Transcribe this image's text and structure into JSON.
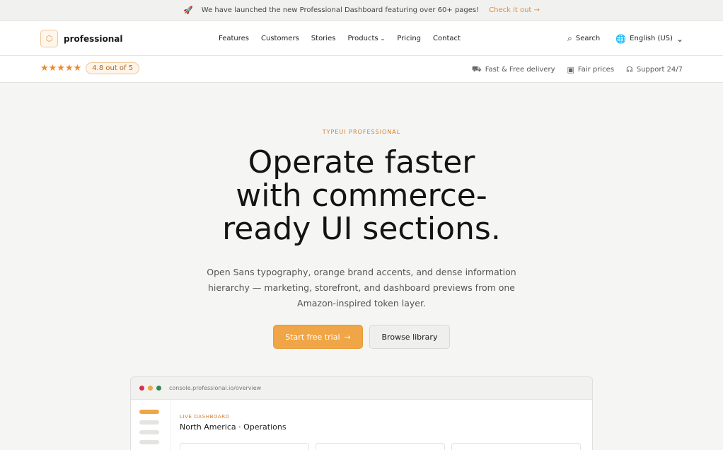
{
  "announcement": {
    "icon": "rocket-icon",
    "text": "We have launched the new Professional Dashboard featuring over 60+ pages!",
    "cta": "Check it out",
    "accent": "#e98a2c"
  },
  "nav": {
    "brand": "professional",
    "links": [
      "Features",
      "Customers",
      "Stories",
      "Products",
      "Pricing",
      "Contact"
    ],
    "search_label": "Search",
    "language_label": "English (US)"
  },
  "subbar": {
    "stars": 5,
    "rating_text": "4.8 out of 5",
    "perks": [
      "Fast & Free delivery",
      "Fair prices",
      "Support 24/7"
    ]
  },
  "hero": {
    "eyebrow": "TYPEUI PROFESSIONAL",
    "headline_lines": [
      "Operate faster",
      "with commerce-",
      "ready UI sections."
    ],
    "subtitle": "Open Sans typography, orange brand accents, and dense information hierarchy — marketing, storefront, and dashboard previews from one Amazon-inspired token layer.",
    "primary_cta": "Start free trial",
    "secondary_cta": "Browse library"
  },
  "preview": {
    "url": "console.professional.io/overview",
    "label": "LIVE DASHBOARD",
    "title": "North America · Operations",
    "window_dots": [
      "#d6304a",
      "#f0a646",
      "#2f8a4f"
    ]
  }
}
